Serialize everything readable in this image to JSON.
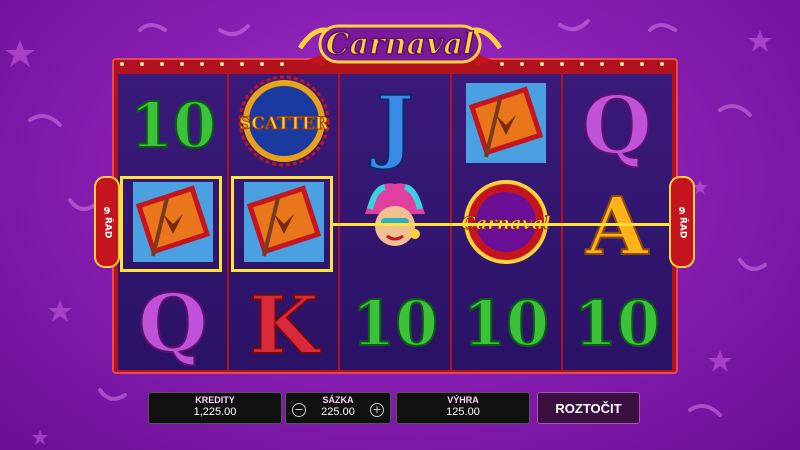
{
  "game": {
    "title": "Carnaval"
  },
  "reels": [
    [
      "10",
      "flag",
      "Q"
    ],
    [
      "scatter",
      "flag",
      "K"
    ],
    [
      "J",
      "mask-girl",
      "10"
    ],
    [
      "flag",
      "carnaval",
      "10"
    ],
    [
      "Q",
      "A",
      "10"
    ]
  ],
  "symbols": {
    "scatter_text": "SCATTER",
    "carnaval_text": "Carnaval"
  },
  "payline": {
    "left_label_num": "9",
    "left_label_word": "ŘAD",
    "right_label_num": "9",
    "right_label_word": "ŘAD"
  },
  "panel": {
    "credits_label": "KREDITY",
    "credits_value": "1,225.00",
    "bet_label": "SÁZKA",
    "bet_value": "225.00",
    "win_label": "VÝHRA",
    "win_value": "125.00",
    "spin_label": "ROZTOČIT",
    "minus_glyph": "−",
    "plus_glyph": "+"
  },
  "colors": {
    "background": "#8a1fb4",
    "frame": "#b2121e",
    "win_highlight": "#ffe23a",
    "reel_bg": "#2a1266"
  }
}
